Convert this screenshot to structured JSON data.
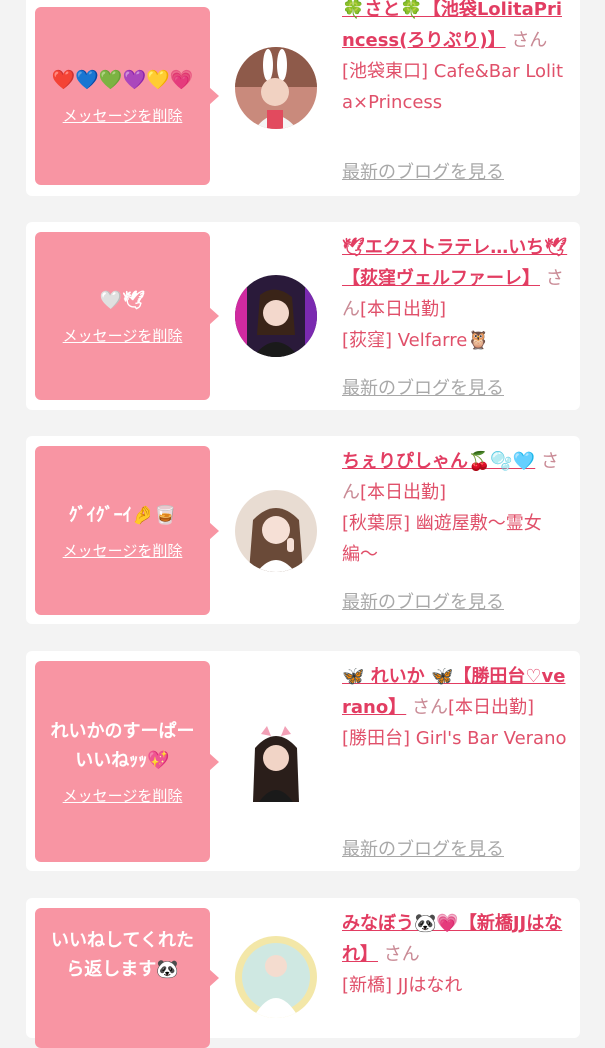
{
  "delete_label": "メッセージを削除",
  "blog_label": "最新のブログを見る",
  "san": "さん",
  "cards": [
    {
      "message": "❤️💙💚💜💛💗",
      "name": "🍀さと🍀【池袋LolitaPrincess(ろりぷり)】",
      "suffix": "",
      "shop": "[池袋東口] Cafe&Bar Lolita×Princess"
    },
    {
      "message": "🤍🕊",
      "name": "🕊エクストラテレ…いち🕊【荻窪ヴェルファーレ】",
      "suffix": "[本日出勤]",
      "shop": "[荻窪] Velfarre🦉"
    },
    {
      "message": "ｸﾞｲｸﾞｰｲ🤌🥃",
      "name": "ちぇりぴしゃん🍒🫧🩵",
      "suffix": "[本日出勤]",
      "shop": "[秋葉原] 幽遊屋敷〜霊女編〜"
    },
    {
      "message": "れいかのすーぱーいいねｯｯ💖",
      "name": "🦋 れいか 🦋【勝田台♡verano】",
      "suffix": "[本日出勤]",
      "shop": "[勝田台] Girl's Bar Verano"
    },
    {
      "message": "いいねしてくれたら返します🐼",
      "name": "みなぼう🐼💗【新橋JJはなれ】",
      "suffix": "",
      "shop": "[新橋] JJはなれ"
    }
  ]
}
